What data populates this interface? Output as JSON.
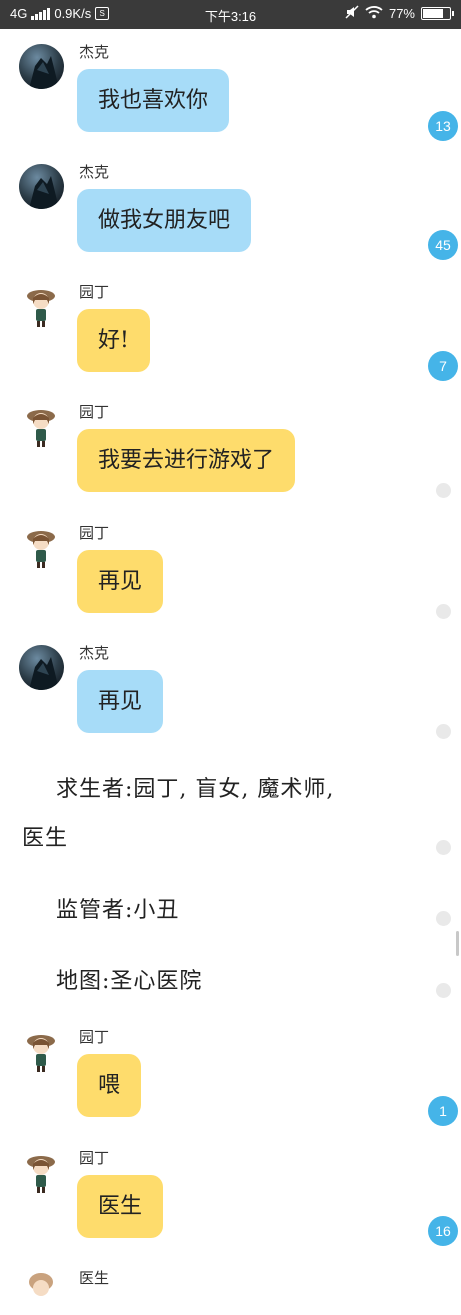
{
  "status_bar": {
    "network": "4G",
    "speed": "0.9K/s",
    "time": "下午3:16",
    "battery": "77%",
    "battery_level": 0.77
  },
  "messages": [
    {
      "sender": "杰克",
      "text": "我也喜欢你",
      "badge": "13",
      "avatar": "jack-avatar",
      "color": "blue"
    },
    {
      "sender": "杰克",
      "text": "做我女朋友吧",
      "badge": "45",
      "avatar": "jack-avatar",
      "color": "blue"
    },
    {
      "sender": "园丁",
      "text": "好!",
      "badge": "7",
      "avatar": "gardener-avatar",
      "color": "yellow"
    },
    {
      "sender": "园丁",
      "text": "我要去进行游戏了",
      "badge": "",
      "avatar": "gardener-avatar",
      "color": "yellow"
    },
    {
      "sender": "园丁",
      "text": "再见",
      "badge": "",
      "avatar": "gardener-avatar",
      "color": "yellow"
    },
    {
      "sender": "杰克",
      "text": "再见",
      "badge": "",
      "avatar": "jack-avatar",
      "color": "blue"
    },
    {
      "sender": "园丁",
      "text": "喂",
      "badge": "1",
      "avatar": "gardener-avatar",
      "color": "yellow"
    },
    {
      "sender": "园丁",
      "text": "医生",
      "badge": "16",
      "avatar": "gardener-avatar",
      "color": "yellow"
    },
    {
      "sender": "医生",
      "text": "",
      "badge": "",
      "avatar": "doctor-avatar",
      "color": "yellow"
    }
  ],
  "narration": {
    "survivors_line1": "求生者:园丁, 盲女, 魔术师,",
    "survivors_line2": "医生",
    "hunter": "监管者:小丑",
    "map": "地图:圣心医院"
  },
  "colors": {
    "blue_bubble": "#a7dcf8",
    "yellow_bubble": "#fedc6c",
    "badge": "#45b4e8",
    "status_bar": "#3a3a3a"
  }
}
